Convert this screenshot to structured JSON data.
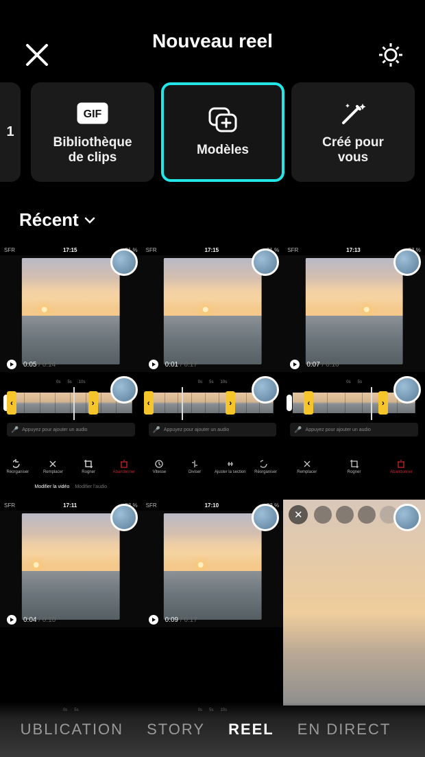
{
  "header": {
    "title": "Nouveau reel"
  },
  "categories": {
    "stub": "1",
    "library": "Bibliothèque\nde clips",
    "templates": "Modèles",
    "created": "Créé pour\nvous"
  },
  "recent": {
    "label": "Récent"
  },
  "grid": {
    "row1": [
      {
        "carrier": "SFR",
        "time": "17:15",
        "battery": "81 %",
        "dur_a": "0:05",
        "dur_b": " / 0:14"
      },
      {
        "carrier": "SFR",
        "time": "17:15",
        "battery": "81 %",
        "dur_a": "0:01",
        "dur_b": " / 0:17"
      },
      {
        "carrier": "SFR",
        "time": "17:13",
        "battery": "83 %",
        "dur_a": "0:07",
        "dur_b": " / 0:10"
      }
    ],
    "row3": [
      {
        "carrier": "SFR",
        "time": "17:11",
        "battery": "83 %",
        "dur_a": "0:04",
        "dur_b": " / 0:10"
      },
      {
        "carrier": "SFR",
        "time": "17:10",
        "battery": "83 %",
        "dur_a": "0:09",
        "dur_b": " / 0:17"
      }
    ],
    "editorA": {
      "audio_hint": "Appuyez pour ajouter un audio",
      "tools": [
        "Réorganiser",
        "Remplacer",
        "Rogner",
        "Abandonner"
      ],
      "tabs": [
        "Modifier la vidéo",
        "Modifier l'audio"
      ]
    },
    "editorB": {
      "audio_hint": "Appuyez pour ajouter un audio",
      "tools": [
        "Vitesse",
        "Diviser",
        "Ajuster la section",
        "Réorganiser",
        "Remplacer",
        "Rogner",
        "Abandonner"
      ]
    }
  },
  "tabs": {
    "publication": "UBLICATION",
    "story": "STORY",
    "reel": "REEL",
    "direct": "EN DIRECT"
  }
}
